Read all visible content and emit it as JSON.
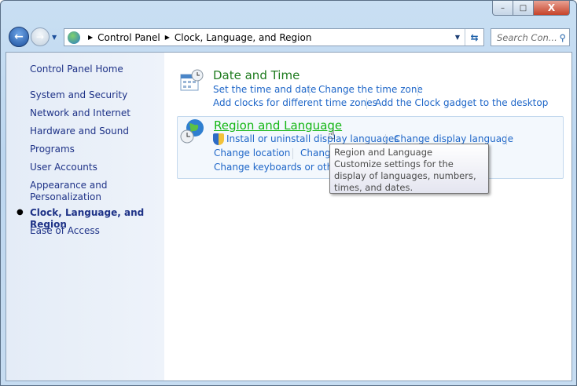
{
  "window": {
    "minimize": "–",
    "maximize": "□",
    "close": "X"
  },
  "address": {
    "crumbs": [
      "Control Panel",
      "Clock, Language, and Region"
    ]
  },
  "search": {
    "placeholder": "Search Con..."
  },
  "sidebar": {
    "home": "Control Panel Home",
    "items": [
      {
        "label": "System and Security"
      },
      {
        "label": "Network and Internet"
      },
      {
        "label": "Hardware and Sound"
      },
      {
        "label": "Programs"
      },
      {
        "label": "User Accounts"
      },
      {
        "label": "Appearance and Personalization"
      },
      {
        "label": "Clock, Language, and Region",
        "current": true
      },
      {
        "label": "Ease of Access"
      }
    ]
  },
  "categories": [
    {
      "title": "Date and Time",
      "links": [
        "Set the time and date",
        "Change the time zone",
        "Add clocks for different time zones",
        "Add the Clock gadget to the desktop"
      ]
    },
    {
      "title": "Region and Language",
      "links": [
        "Install or uninstall display languages",
        "Change display language",
        "Change location",
        "Change the date, time, or number format",
        "Change keyboards or other input methods"
      ],
      "visible": {
        "l3": "Change",
        "l5": "Change keyboards or other i"
      }
    }
  ],
  "tooltip": {
    "title": "Region and Language",
    "body": "Customize settings for the display of languages, numbers, times, and dates."
  },
  "colors": {
    "link": "#1e66c8",
    "heading": "#1e7b1e",
    "hover": "#13b613",
    "sidebar_link": "#1e3287"
  }
}
